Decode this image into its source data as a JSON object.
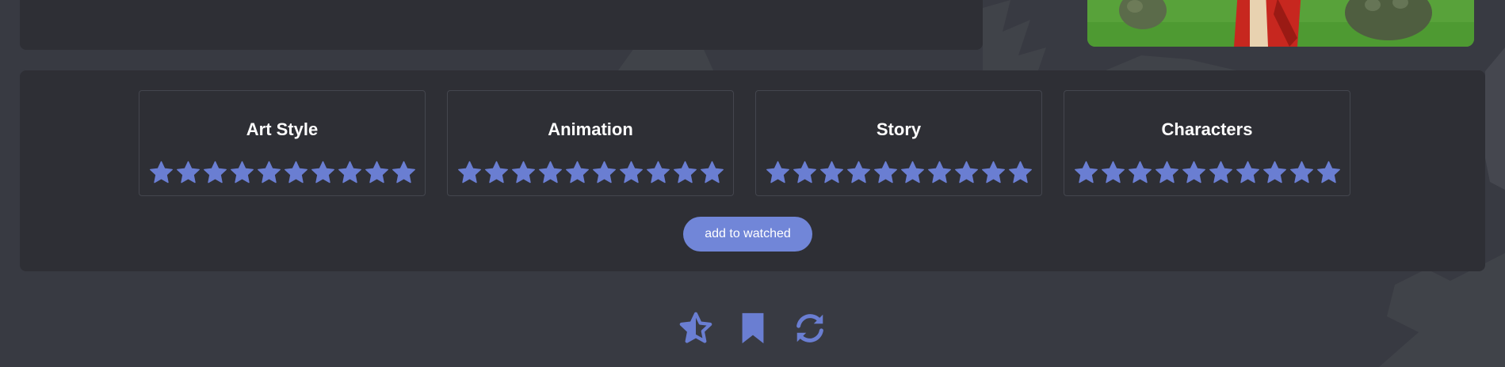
{
  "ratings": [
    {
      "label": "Art Style",
      "stars": 10,
      "max": 10
    },
    {
      "label": "Animation",
      "stars": 10,
      "max": 10
    },
    {
      "label": "Story",
      "stars": 10,
      "max": 10
    },
    {
      "label": "Characters",
      "stars": 10,
      "max": 10
    }
  ],
  "actions": {
    "add_to_watched_label": "add to watched"
  },
  "bottom_icons": [
    "star-half-icon",
    "bookmark-icon",
    "refresh-icon"
  ],
  "colors": {
    "accent": "#7186d8",
    "star": "#6a7ed2",
    "panel": "#2e2f35",
    "background": "#383a42"
  }
}
